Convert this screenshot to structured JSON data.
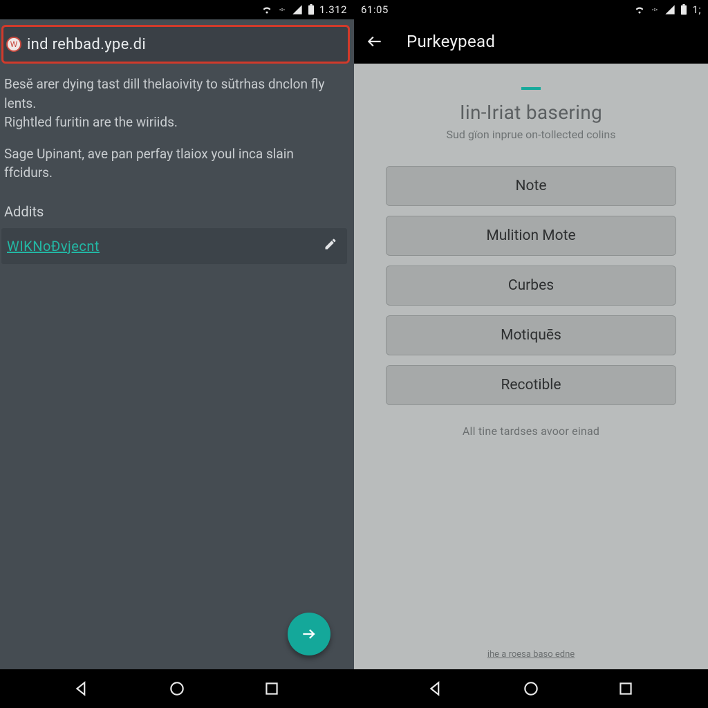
{
  "left": {
    "status": {
      "time": "1.312"
    },
    "url": "ind rehbad.ype.di",
    "para1": "Besĕ arer dying tast dill thelaoivity to sŭtrhas dnclon fly lents.",
    "para2": "Rightled furitin are the wiriids.",
    "para3": "Sage Upinant, ave pan perfay tlaiox youl inca slain ffcidurs.",
    "section": "Addits",
    "link": "WIKNoÐvjecnt"
  },
  "right": {
    "status": {
      "time_left": "61:05",
      "time_right": "1;"
    },
    "header_title": "Purkeypead",
    "heading": "Iin-Iriat basering",
    "subheading": "Sud gïon inprue on-tollected colins",
    "options": [
      "Note",
      "Mulition Mote",
      "Curbes",
      "Motiquēs",
      "Recotible"
    ],
    "footer": "All tine tardses avoor einad",
    "tiny": "ihe a roesa baso edne"
  }
}
